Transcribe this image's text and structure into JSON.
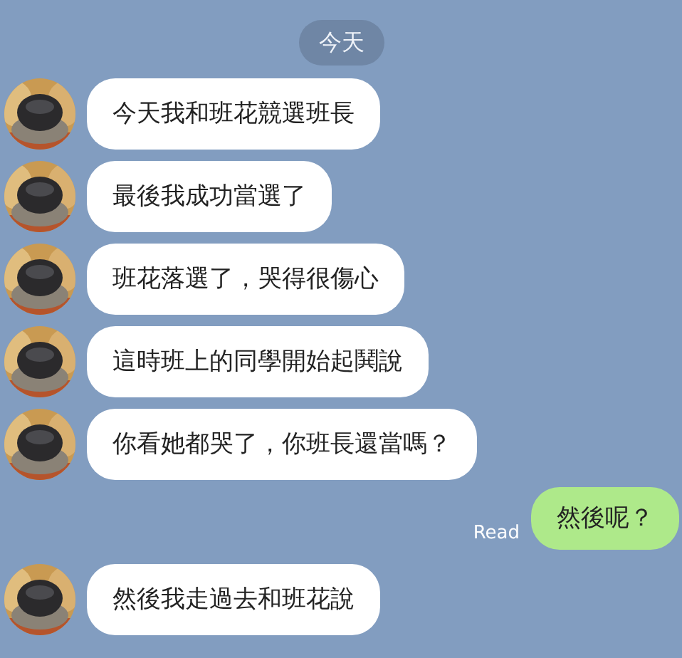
{
  "date_label": "今天",
  "messages": [
    {
      "kind": "received",
      "text": "今天我和班花競選班長"
    },
    {
      "kind": "received",
      "text": "最後我成功當選了"
    },
    {
      "kind": "received",
      "text": "班花落選了，哭得很傷心"
    },
    {
      "kind": "received",
      "text": "這時班上的同學開始起鬨說"
    },
    {
      "kind": "received",
      "text": "你看她都哭了，你班長還當嗎？"
    },
    {
      "kind": "sent",
      "text": "然後呢？",
      "status": "Read"
    },
    {
      "kind": "received",
      "text": "然後我走過去和班花說"
    }
  ]
}
